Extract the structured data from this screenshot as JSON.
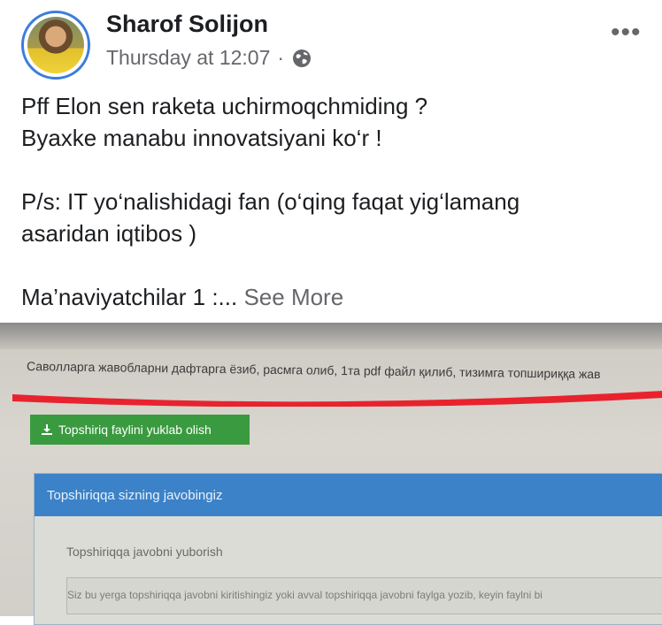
{
  "post": {
    "author": "Sharof Solijon",
    "timestamp": "Thursday at 12:07",
    "separator": "·",
    "privacy_icon": "globe-icon",
    "more_label": "•••",
    "lines": [
      "Pff Elon sen raketa uchirmoqchmiding ?",
      "Byaxke manabu innovatsiyani ko‘r !",
      "P/s: IT yo‘nalishidagi fan (o‘qing faqat yig‘lamang",
      "asaridan iqtibos )",
      "Ma’naviyatchilar 1 :..."
    ],
    "see_more": "See More"
  },
  "photo": {
    "instruction_text": "Саволларга жавобларни дафтарга ёзиб, расмга олиб, 1та pdf файл қилиб, тизимга топшириққа жав",
    "download_button": "Topshiriq faylini yuklab olish",
    "download_icon": "download-icon",
    "panel_title": "Topshiriqqa sizning javobingiz",
    "panel_label": "Topshiriqqa javobni yuborish",
    "panel_hint": "Siz bu yerga topshiriqqa javobni kiritishingiz yoki avval topshiriqqa javobni faylga yozib, keyin faylni bi",
    "mark_color": "#e8232e",
    "button_color": "#3a9a3f",
    "panel_header_color": "#3c82c8"
  }
}
